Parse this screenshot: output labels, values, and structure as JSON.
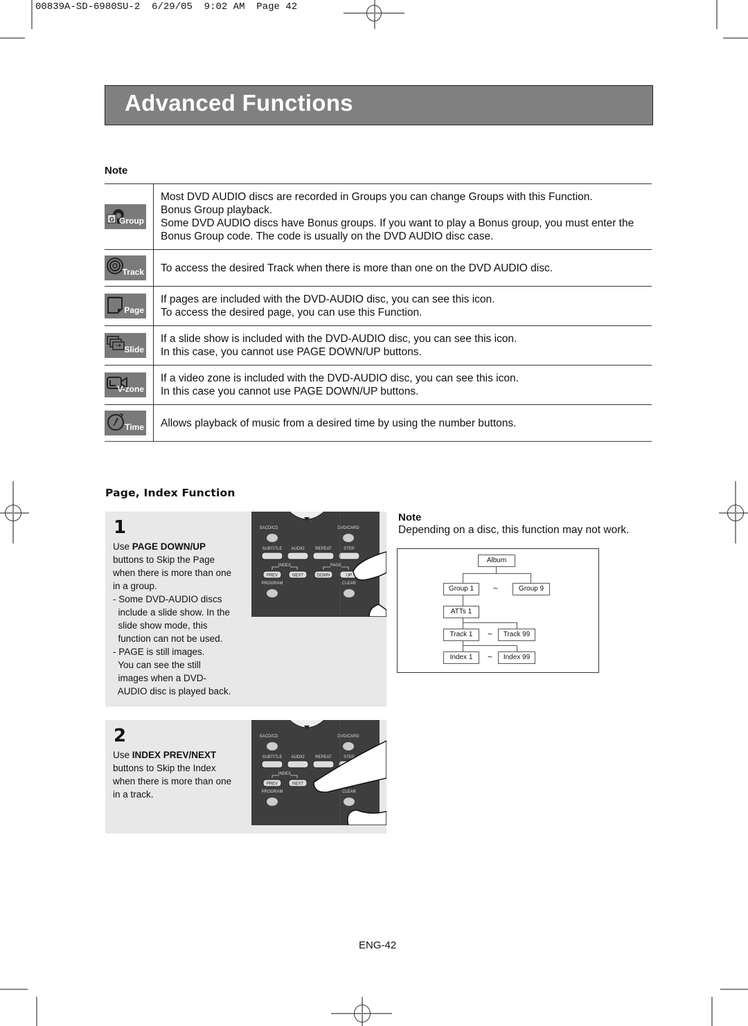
{
  "print_slug": {
    "job": "00839A-SD-6980SU-2",
    "date": "6/29/05",
    "time": "9:02 AM",
    "page": "Page 42"
  },
  "header": {
    "title": "Advanced Functions"
  },
  "notes_section": {
    "title": "Note",
    "rows": [
      {
        "icon": "group-icon",
        "icon_label": "Group",
        "lines": [
          "Most DVD AUDIO discs are recorded in Groups you can change Groups with this Function.",
          "Bonus Group playback.",
          "Some DVD AUDIO discs have Bonus groups. If you want to play a Bonus group, you must enter the",
          "Bonus Group code. The code is usually on the DVD AUDIO disc case."
        ]
      },
      {
        "icon": "track-icon",
        "icon_label": "Track",
        "lines": [
          "To access the desired Track when there is more than one on the DVD AUDIO disc."
        ]
      },
      {
        "icon": "page-icon",
        "icon_label": "Page",
        "lines": [
          "If pages are included with the DVD-AUDIO disc, you can see this icon.",
          "To access the desired page, you can use this Function."
        ]
      },
      {
        "icon": "slide-icon",
        "icon_label": "Slide",
        "lines": [
          "If a slide show is included with the DVD-AUDIO disc, you can see this icon.",
          "In this case, you cannot use PAGE DOWN/UP buttons."
        ]
      },
      {
        "icon": "video-zone-icon",
        "icon_label": "V-zone",
        "lines": [
          "If a video zone is included with the DVD-AUDIO disc, you can see this icon.",
          "In this case you cannot use PAGE DOWN/UP buttons."
        ]
      },
      {
        "icon": "time-icon",
        "icon_label": "Time",
        "lines": [
          "Allows playback of music from a desired time by using the number buttons."
        ]
      }
    ]
  },
  "page_index": {
    "title": "Page, Index Function",
    "steps": [
      {
        "number": "1",
        "prefix": "Use ",
        "bold": "PAGE DOWN/UP",
        "text_lines": [
          "buttons to Skip the Page",
          "when there is more than one",
          "in a group.",
          "- Some DVD-AUDIO discs",
          "  include a slide show. In the",
          "  slide show mode, this",
          "  function can not be used.",
          "- PAGE is still images.",
          "  You can see the still",
          "  images when a DVD-",
          "  AUDIO disc is played back."
        ]
      },
      {
        "number": "2",
        "prefix": "Use ",
        "bold": "INDEX PREV/NEXT",
        "text_lines": [
          "buttons to Skip the Index",
          "when there is more than one",
          "in a track."
        ]
      }
    ],
    "remote": {
      "top_left": "SACD/CD",
      "top_right": "DVD/CARD",
      "row_labels": [
        "SUBTITLE",
        "AUDIO",
        "REPEAT",
        "STEP"
      ],
      "index_label": "INDEX",
      "page_label": "PAGE",
      "buttons": [
        "PREV",
        "NEXT",
        "DOWN",
        "UP"
      ],
      "bottom_left": "PROGRAM",
      "bottom_right": "CLEAR"
    },
    "note": {
      "title": "Note",
      "text": "Depending on a disc, this function may not work."
    },
    "hierarchy": {
      "album": "Album",
      "group_first": "Group 1",
      "group_last": "Group 9",
      "atts": "ATTs 1",
      "track_first": "Track 1",
      "track_last": "Track 99",
      "index_first": "Index 1",
      "index_last": "Index 99",
      "range_symbol": "~"
    }
  },
  "footer": {
    "page_number": "ENG-42"
  }
}
